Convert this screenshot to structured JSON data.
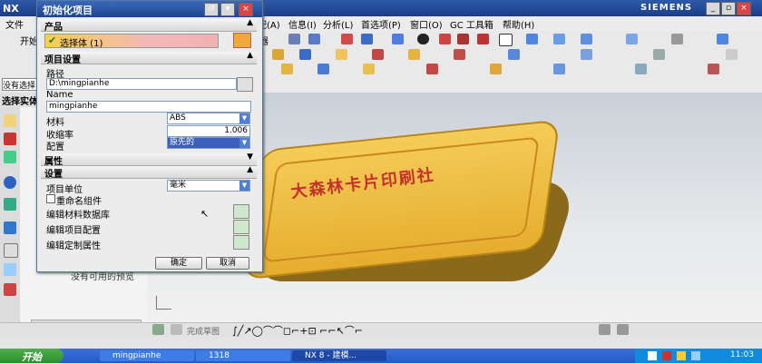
{
  "window": {
    "app_name": "NX",
    "siemens": "SIEMENS"
  },
  "menubar": {
    "items_visible": [
      "文件",
      "配(A)",
      "信息(I)",
      "分析(L)",
      "首选项(P)",
      "窗口(O)",
      "GC 工具箱",
      "帮助(H)"
    ]
  },
  "toolbar": {
    "start_label": "开始",
    "selection_filter": "没有选择",
    "selection_label": "选择实体",
    "partial_text": "器"
  },
  "navigator": {
    "empty_text": "没有可用的预览"
  },
  "viewport": {
    "part_engraving": "大森林卡片印刷社"
  },
  "bottom": {
    "snap_label": "完成草图"
  },
  "dialog": {
    "title": "初始化项目",
    "product_section": "产品",
    "select_body": "选择体 (1)",
    "project_settings_section": "项目设置",
    "path_label": "路径",
    "path_value": "D:\\mingpianhe",
    "name_label": "Name",
    "name_value": "mingpianhe",
    "material_label": "材料",
    "material_value": "ABS",
    "shrinkage_label": "收缩率",
    "shrinkage_value": "1.006",
    "config_label": "配置",
    "config_value": "原先的",
    "properties_section": "属性",
    "settings_section": "设置",
    "unit_label": "项目单位",
    "unit_value": "毫米",
    "rename_label": "重命名组件",
    "edit_material_db": "编辑材料数据库",
    "edit_project_config": "编辑项目配置",
    "edit_custom_props": "编辑定制属性",
    "ok": "确定",
    "cancel": "取消"
  },
  "taskbar": {
    "start": "开始",
    "tasks": [
      "mingpianhe",
      "1318",
      "NX 8 - 建模..."
    ],
    "time": "11:03"
  },
  "colors": {
    "title_blue": "#1c4592",
    "taskbar_blue": "#245bc8",
    "part_gold": "#e5ad2e",
    "engraving_red": "#c6302c"
  }
}
